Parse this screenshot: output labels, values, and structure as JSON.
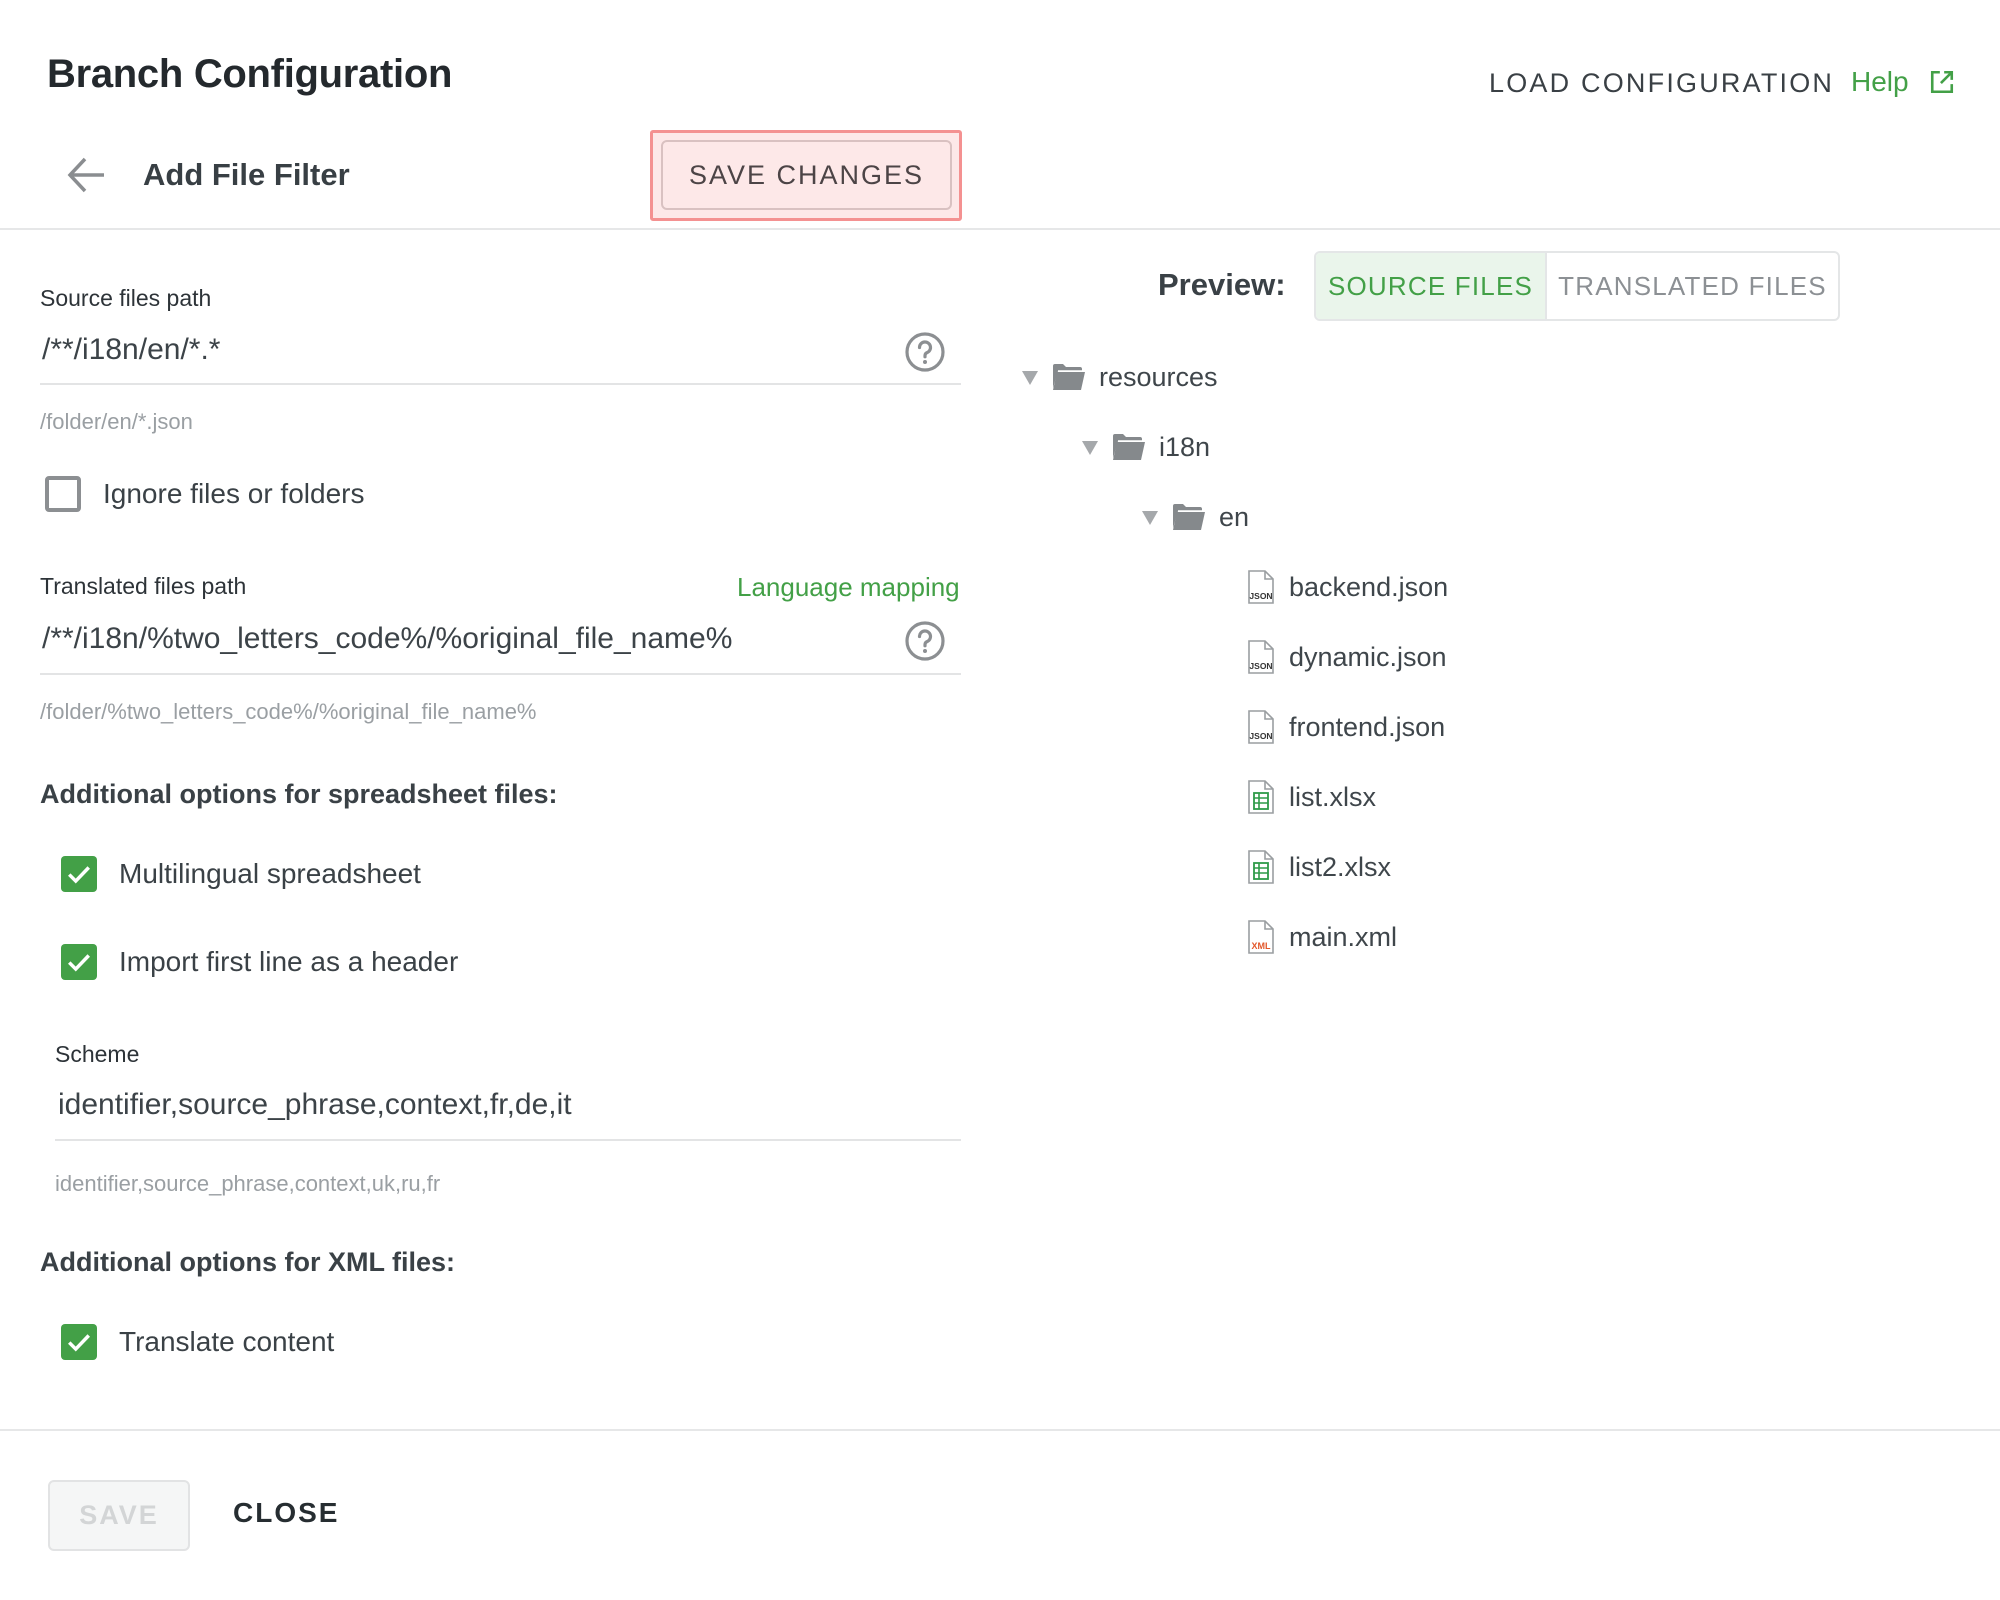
{
  "header": {
    "title": "Branch Configuration",
    "load_configuration_label": "LOAD CONFIGURATION",
    "help_label": "Help",
    "help_icon": "external-link-icon"
  },
  "subheader": {
    "back_icon": "arrow-left-icon",
    "title": "Add File Filter",
    "save_changes_label": "SAVE CHANGES"
  },
  "form": {
    "source_path": {
      "label": "Source files path",
      "value": "/**/i18n/en/*.*",
      "hint": "/folder/en/*.json",
      "help_icon": "question-circle-icon"
    },
    "ignore_files": {
      "label": "Ignore files or folders",
      "checked": false
    },
    "translated_path": {
      "label": "Translated files path",
      "language_mapping_label": "Language mapping",
      "value": "/**/i18n/%two_letters_code%/%original_file_name%",
      "hint": "/folder/%two_letters_code%/%original_file_name%",
      "help_icon": "question-circle-icon"
    },
    "spreadsheet_section": {
      "heading": "Additional options for spreadsheet files:",
      "options": [
        {
          "label": "Multilingual spreadsheet",
          "checked": true
        },
        {
          "label": "Import first line as a header",
          "checked": true
        }
      ],
      "scheme": {
        "label": "Scheme",
        "value": "identifier,source_phrase,context,fr,de,it",
        "hint": "identifier,source_phrase,context,uk,ru,fr"
      }
    },
    "xml_section": {
      "heading": "Additional options for XML files:",
      "options": [
        {
          "label": "Translate content",
          "checked": true
        }
      ]
    }
  },
  "preview": {
    "label": "Preview:",
    "tabs": [
      {
        "label": "SOURCE FILES",
        "active": true
      },
      {
        "label": "TRANSLATED FILES",
        "active": false
      }
    ],
    "tree": [
      {
        "name": "resources",
        "type": "folder",
        "expanded": true,
        "depth": 0
      },
      {
        "name": "i18n",
        "type": "folder",
        "expanded": true,
        "depth": 1
      },
      {
        "name": "en",
        "type": "folder",
        "expanded": true,
        "depth": 2
      },
      {
        "name": "backend.json",
        "type": "json",
        "depth": 3
      },
      {
        "name": "dynamic.json",
        "type": "json",
        "depth": 3
      },
      {
        "name": "frontend.json",
        "type": "json",
        "depth": 3
      },
      {
        "name": "list.xlsx",
        "type": "xlsx",
        "depth": 3
      },
      {
        "name": "list2.xlsx",
        "type": "xlsx",
        "depth": 3
      },
      {
        "name": "main.xml",
        "type": "xml",
        "depth": 3
      }
    ],
    "file_icon_labels": {
      "json": "JSON",
      "xml": "XML"
    }
  },
  "footer": {
    "save_label": "SAVE",
    "close_label": "CLOSE"
  },
  "colors": {
    "accent_green": "#43a047",
    "highlight_red": "#f49191",
    "highlight_fill": "#fde8e8",
    "xml_orange": "#e2572b"
  }
}
